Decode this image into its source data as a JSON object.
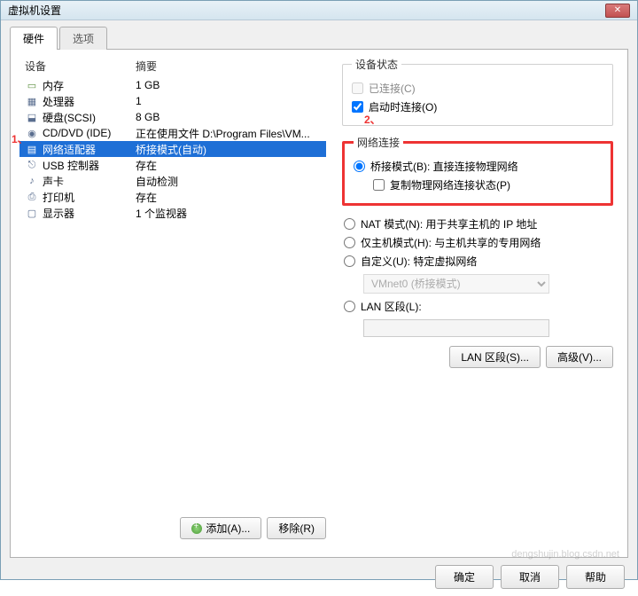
{
  "window": {
    "title": "虚拟机设置"
  },
  "tabs": {
    "hardware": "硬件",
    "options": "选项"
  },
  "columns": {
    "device": "设备",
    "summary": "摘要"
  },
  "devices": [
    {
      "icon": "chip-icon",
      "name": "内存",
      "summary": "1 GB"
    },
    {
      "icon": "cpu-icon",
      "name": "处理器",
      "summary": "1"
    },
    {
      "icon": "disk-icon",
      "name": "硬盘(SCSI)",
      "summary": "8 GB"
    },
    {
      "icon": "cd-icon",
      "name": "CD/DVD (IDE)",
      "summary": "正在使用文件 D:\\Program Files\\VM..."
    },
    {
      "icon": "net-icon",
      "name": "网络适配器",
      "summary": "桥接模式(自动)"
    },
    {
      "icon": "usb-icon",
      "name": "USB 控制器",
      "summary": "存在"
    },
    {
      "icon": "sound-icon",
      "name": "声卡",
      "summary": "自动检测"
    },
    {
      "icon": "print-icon",
      "name": "打印机",
      "summary": "存在"
    },
    {
      "icon": "display-icon",
      "name": "显示器",
      "summary": "1 个监视器"
    }
  ],
  "annotations": {
    "a1": "1、",
    "a2": "2、"
  },
  "buttons": {
    "add": "添加(A)...",
    "remove": "移除(R)",
    "lanSegment": "LAN 区段(S)...",
    "advanced": "高级(V)...",
    "ok": "确定",
    "cancel": "取消",
    "help": "帮助"
  },
  "right": {
    "deviceStatus": {
      "legend": "设备状态",
      "connected": "已连接(C)",
      "connectAtPower": "启动时连接(O)"
    },
    "netConn": {
      "legend": "网络连接",
      "bridge": "桥接模式(B): 直接连接物理网络",
      "replicate": "复制物理网络连接状态(P)",
      "nat": "NAT 模式(N): 用于共享主机的 IP 地址",
      "hostOnly": "仅主机模式(H): 与主机共享的专用网络",
      "custom": "自定义(U): 特定虚拟网络",
      "customCombo": "VMnet0 (桥接模式)",
      "lan": "LAN 区段(L):"
    }
  },
  "watermark": "dengshujin.blog.csdn.net"
}
